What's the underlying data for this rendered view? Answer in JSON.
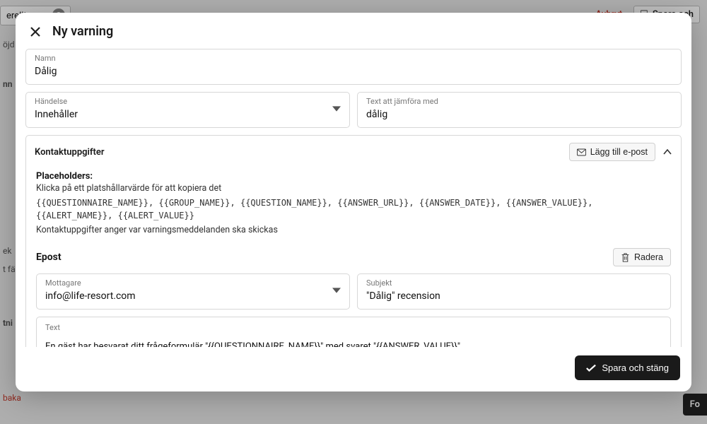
{
  "background": {
    "select_value": "erellt",
    "cancel": "Avbryt",
    "save": "Spara och",
    "left_items": [
      "öjd",
      "nn",
      "ek",
      "t fä",
      "tni",
      "baka"
    ],
    "fo": "Fo"
  },
  "modal": {
    "title": "Ny varning",
    "name": {
      "label": "Namn",
      "value": "Dålig"
    },
    "event": {
      "label": "Händelse",
      "value": "Innehåller"
    },
    "compare": {
      "label": "Text att jämföra med",
      "value": "dålig"
    },
    "contact": {
      "title": "Kontaktuppgifter",
      "add_email": "Lägg till e-post",
      "placeholders_title": "Placeholders:",
      "placeholders_desc": "Klicka på ett platshållarvärde för att kopiera det",
      "placeholders_code": "{{QUESTIONNAIRE_NAME}}, {{GROUP_NAME}}, {{QUESTION_NAME}}, {{ANSWER_URL}}, {{ANSWER_DATE}}, {{ANSWER_VALUE}}, {{ALERT_NAME}}, {{ALERT_VALUE}}",
      "placeholders_note": "Kontaktuppgifter anger var varningsmeddelanden ska skickas"
    },
    "epost": {
      "title": "Epost",
      "delete": "Radera",
      "recipients": {
        "label": "Mottagare",
        "value": "info@life-resort.com"
      },
      "subject": {
        "label": "Subjekt",
        "value": "\"Dålig\" recension"
      },
      "text_label": "Text"
    },
    "save_close": "Spara och stäng"
  }
}
